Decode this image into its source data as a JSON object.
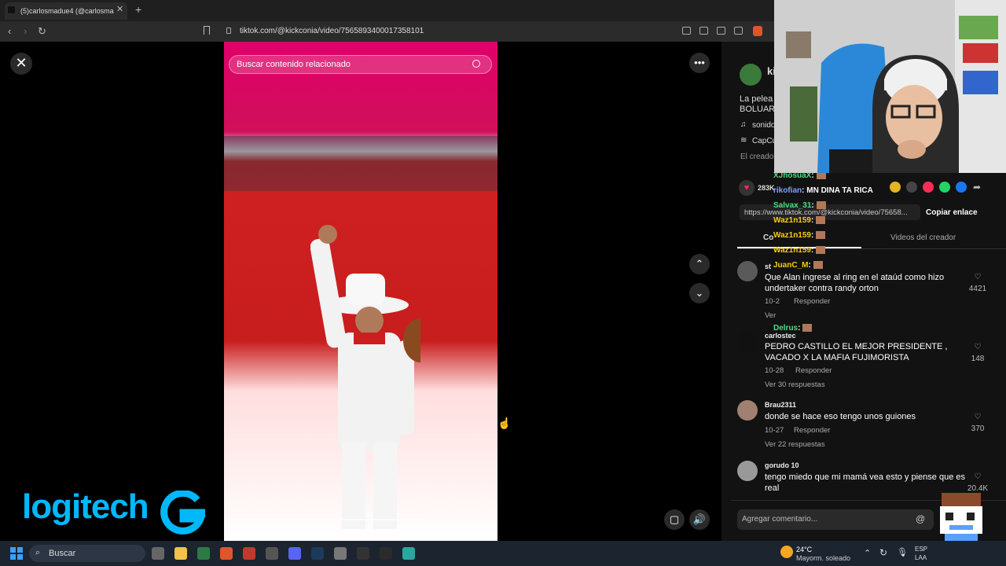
{
  "browser": {
    "tab_title": "(5)carlosmadue4 (@carlosma",
    "url": "tiktok.com/@kickconia/video/7565893400017358101"
  },
  "video": {
    "search_placeholder": "Buscar contenido relacionado"
  },
  "sidebar": {
    "username_partial": "ki",
    "description_line1": "La pelea",
    "description_line2": "BOLUART",
    "sound_label": "sonido",
    "capcut_label": "CapCu",
    "creator_label": "El creador",
    "likes_count": "283K",
    "link_url": "https://www.tiktok.com/@kickconia/video/75658...",
    "copy_link_label": "Copiar enlace",
    "tab_comments": "Co",
    "tab_creator_videos": "Videos del creador",
    "comments": [
      {
        "user": "st",
        "text": "Que Alan ingrese al ring en el ataúd como hizo undertaker contra randy orton",
        "date": "10-2",
        "reply": "Responder",
        "replies": "Ver",
        "likes": "4421"
      },
      {
        "user": "carlostec",
        "text": "PEDRO CASTILLO EL MEJOR PRESIDENTE , VACADO X LA MAFIA FUJIMORISTA",
        "date": "10-28",
        "reply": "Responder",
        "replies": "Ver 30 respuestas",
        "likes": "148"
      },
      {
        "user": "Brau2311",
        "text": "donde se hace eso tengo unos guiones",
        "date": "10-27",
        "reply": "Responder",
        "replies": "Ver 22 respuestas",
        "likes": "370"
      },
      {
        "user": "gorudo 10",
        "text": "tengo miedo que mi mamá vea esto y piense que es real",
        "date": "",
        "reply": "",
        "replies": "",
        "likes": "20.4K"
      }
    ],
    "comment_placeholder": "Agregar comentario..."
  },
  "chat": [
    {
      "user": "XJhosuaX",
      "msg": ":",
      "color": "#4ade80"
    },
    {
      "user": "rikofian",
      "msg": ": MN DINA TA RICA",
      "color": "#7aa2ff"
    },
    {
      "user": "Salvax_31",
      "msg": ":",
      "color": "#4ade80"
    },
    {
      "user": "Waz1n159",
      "msg": ":",
      "color": "#facc15"
    },
    {
      "user": "Waz1n159",
      "msg": ":",
      "color": "#facc15"
    },
    {
      "user": "Waz1n159",
      "msg": ":",
      "color": "#facc15"
    },
    {
      "user": "JuanC_M",
      "msg": ":",
      "color": "#facc15"
    },
    {
      "user": "Delrus",
      "msg": ":",
      "color": "#4ade80"
    }
  ],
  "taskbar": {
    "search_label": "Buscar",
    "temperature": "24°C",
    "weather": "Mayorm. soleado",
    "lang1": "ESP",
    "lang2": "LAA"
  },
  "overlay": {
    "logo_text": "logitech"
  },
  "colors": {
    "tiktok_pink": "#fe2c55",
    "sidebar_bg": "#121212",
    "logitech_blue": "#00b8fc"
  }
}
